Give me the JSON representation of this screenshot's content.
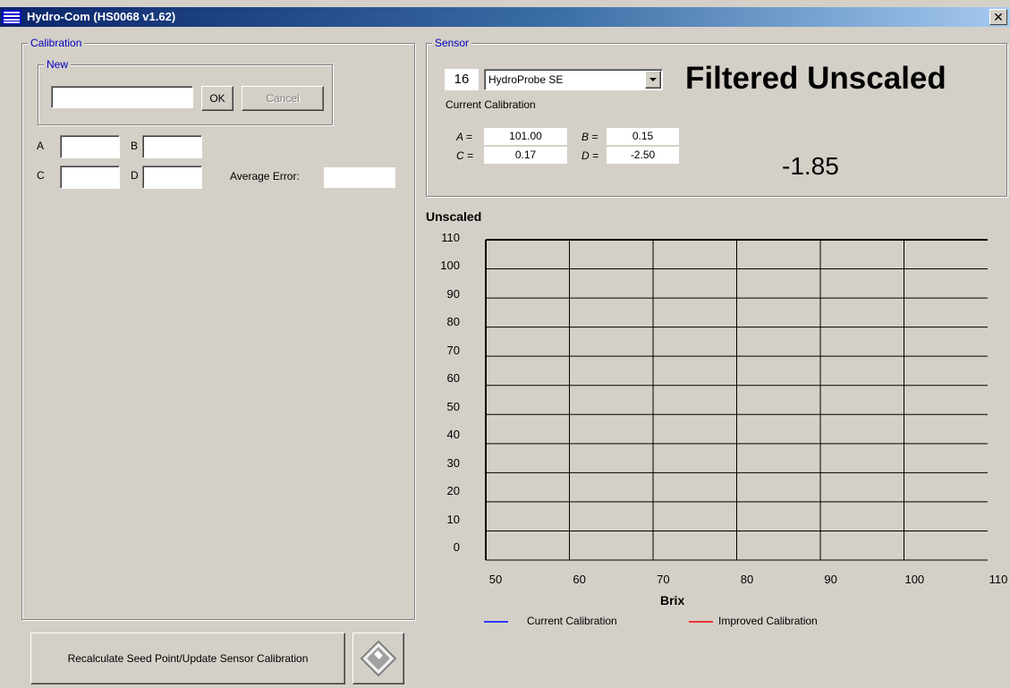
{
  "window": {
    "title": "Hydro-Com (HS0068 v1.62)",
    "close_glyph": "✕",
    "icon": "app-menu-icon"
  },
  "calibration": {
    "group_label": "Calibration",
    "new": {
      "group_label": "New",
      "input_value": "",
      "ok_label": "OK",
      "cancel_label": "Cancel"
    },
    "coefficients": {
      "a_label": "A",
      "a_value": "",
      "b_label": "B",
      "b_value": "",
      "c_label": "C",
      "c_value": "",
      "d_label": "D",
      "d_value": ""
    },
    "average_error_label": "Average Error:",
    "average_error_value": ""
  },
  "sensor": {
    "group_label": "Sensor",
    "address": "16",
    "type_selected": "HydroProbe SE",
    "current_calibration_label": "Current Calibration",
    "a_label": "A =",
    "a_value": "101.00",
    "b_label": "B =",
    "b_value": "0.15",
    "c_label": "C =",
    "c_value": "0.17",
    "d_label": "D =",
    "d_value": "-2.50",
    "mode_title": "Filtered Unscaled",
    "reading": "-1.85"
  },
  "chart_data": {
    "type": "line",
    "title": "",
    "ylabel": "Unscaled",
    "xlabel": "Brix",
    "xlim": [
      50,
      110
    ],
    "ylim": [
      0,
      110
    ],
    "x_ticks": [
      "50",
      "60",
      "70",
      "80",
      "90",
      "100",
      "110"
    ],
    "y_ticks": [
      "110",
      "100",
      "90",
      "80",
      "70",
      "60",
      "50",
      "40",
      "30",
      "20",
      "10",
      "0"
    ],
    "grid": true,
    "series": [
      {
        "name": "Current Calibration",
        "color": "#0000ff",
        "points": []
      },
      {
        "name": "Improved Calibration",
        "color": "#ff0000",
        "points": []
      }
    ],
    "legend_placement": "bottom"
  },
  "actions": {
    "recalculate_label": "Recalculate Seed Point/Update Sensor Calibration",
    "save_icon": "floppy-disk-icon"
  }
}
